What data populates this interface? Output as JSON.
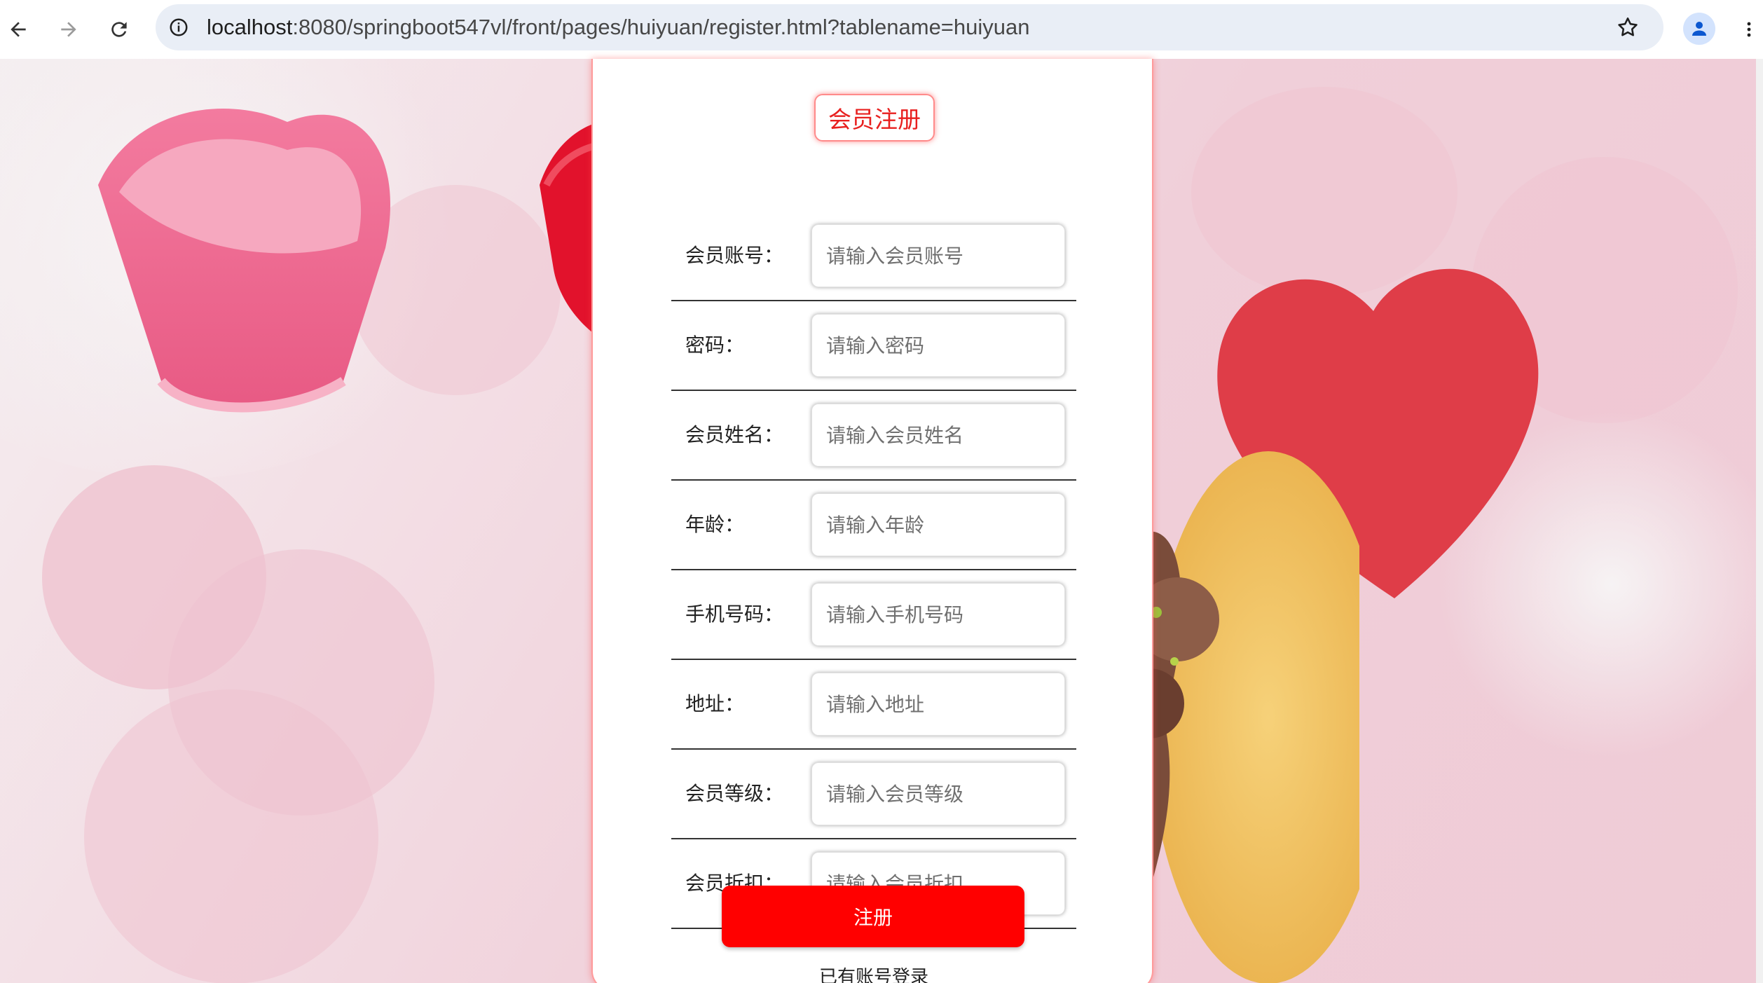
{
  "browser": {
    "url_host": "localhost",
    "url_path": ":8080/springboot547vl/front/pages/huiyuan/register.html?tablename=huiyuan"
  },
  "form": {
    "title": "会员注册",
    "fields": [
      {
        "label": "会员账号：",
        "placeholder": "请输入会员账号"
      },
      {
        "label": "密码：",
        "placeholder": "请输入密码"
      },
      {
        "label": "会员姓名：",
        "placeholder": "请输入会员姓名"
      },
      {
        "label": "年龄：",
        "placeholder": "请输入年龄"
      },
      {
        "label": "手机号码：",
        "placeholder": "请输入手机号码"
      },
      {
        "label": "地址：",
        "placeholder": "请输入地址"
      },
      {
        "label": "会员等级：",
        "placeholder": "请输入会员等级"
      },
      {
        "label": "会员折扣：",
        "placeholder": "请输入会员折扣"
      }
    ],
    "submit_label": "注册",
    "login_link": "已有账号登录"
  },
  "colors": {
    "accent": "#ff0000",
    "title_text": "#e8201f",
    "panel_glow": "#ff9a9a"
  }
}
